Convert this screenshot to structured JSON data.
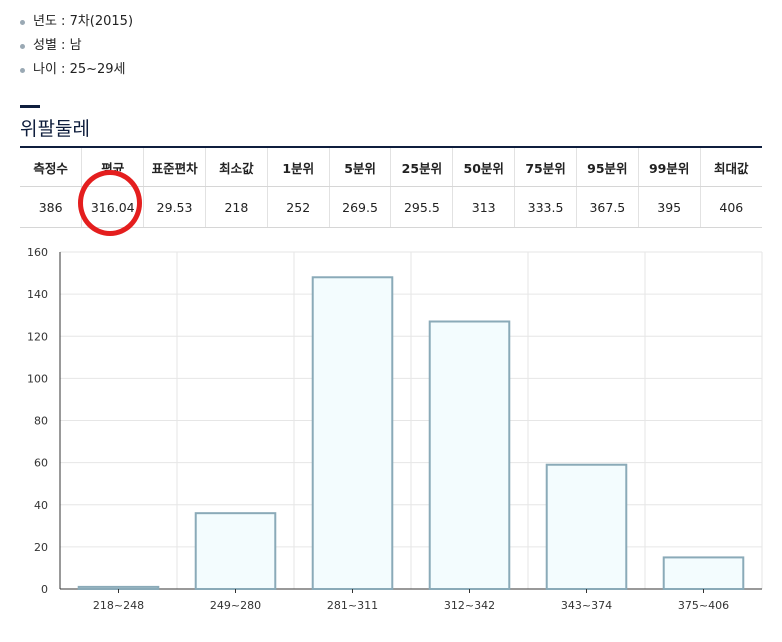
{
  "meta": [
    {
      "label": "년도 : 7차(2015)"
    },
    {
      "label": "성별 : 남"
    },
    {
      "label": "나이 : 25~29세"
    }
  ],
  "section_title": "위팔둘레",
  "stats_table": {
    "headers": [
      "측정수",
      "평균",
      "표준편차",
      "최소값",
      "1분위",
      "5분위",
      "25분위",
      "50분위",
      "75분위",
      "95분위",
      "99분위",
      "최대값"
    ],
    "values": [
      "386",
      "316.04",
      "29.53",
      "218",
      "252",
      "269.5",
      "295.5",
      "313",
      "333.5",
      "367.5",
      "395",
      "406"
    ]
  },
  "colors": {
    "bar_fill": "#f3fcfe",
    "bar_stroke": "#8aaab8",
    "highlight": "#e41e1e",
    "title_navy": "#0f1e3d"
  },
  "chart_data": {
    "type": "bar",
    "categories": [
      "218~248",
      "249~280",
      "281~311",
      "312~342",
      "343~374",
      "375~406"
    ],
    "values": [
      1,
      36,
      148,
      127,
      59,
      15
    ],
    "title": "",
    "xlabel": "",
    "ylabel": "",
    "ylim": [
      0,
      160
    ],
    "yticks": [
      "0",
      "20",
      "40",
      "60",
      "80",
      "100",
      "120",
      "140",
      "160"
    ],
    "grid": true
  }
}
